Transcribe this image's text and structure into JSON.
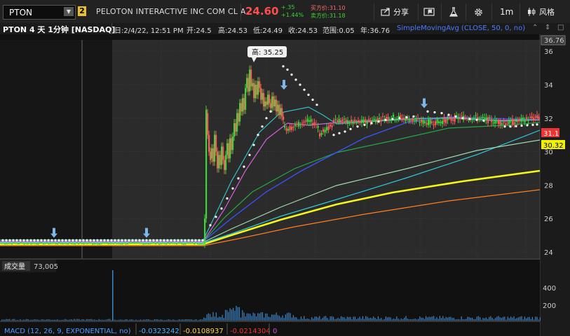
{
  "topbar": {
    "symbol": "PTON",
    "dropdown_icon": "chevron-down-icon",
    "link_badge": "2",
    "company": "PELOTON INTERACTIVE INC COM CL A",
    "price": "24.60",
    "change": "+.35",
    "change_pct": "+1.44%",
    "bid": "买方价:31.10",
    "ask": "卖方价:31.18",
    "share_label": "分享",
    "interval": "1m",
    "style_label": "风格",
    "colors": {
      "price": "#ff4e4e",
      "up": "#3cd33c"
    }
  },
  "info": {
    "title": "PTON 4 天 1分钟 [NASDAQ]",
    "date": "日:2/4/22, 12:51 PM",
    "open": "开:24.5",
    "high": "高:24.53",
    "low": "低:24.49",
    "close": "收:24.53",
    "range": "范围:0.05",
    "ytd": "年:36.76",
    "sma": "SimpleMovingAvg (CLOSE, 50, 0, no)"
  },
  "chart": {
    "y_ticks": [
      "36",
      "34",
      "32",
      "30",
      "28",
      "26",
      "24"
    ],
    "top_price_tag": "36.76",
    "tag_red": "31.1",
    "tag_yellow": "30.32",
    "high_callout": "高: 35.25",
    "volume_label": "成交量",
    "volume_value": "73,005",
    "vol_ticks": [
      "400",
      "200"
    ],
    "macd_label": "MACD (12, 26, 9, EXPONENTIAL, no)",
    "macd_v1": "-0.0323242",
    "macd_v2": "-0.0108937",
    "macd_v3": "-0.0214304",
    "macd_v4": "0"
  }
}
